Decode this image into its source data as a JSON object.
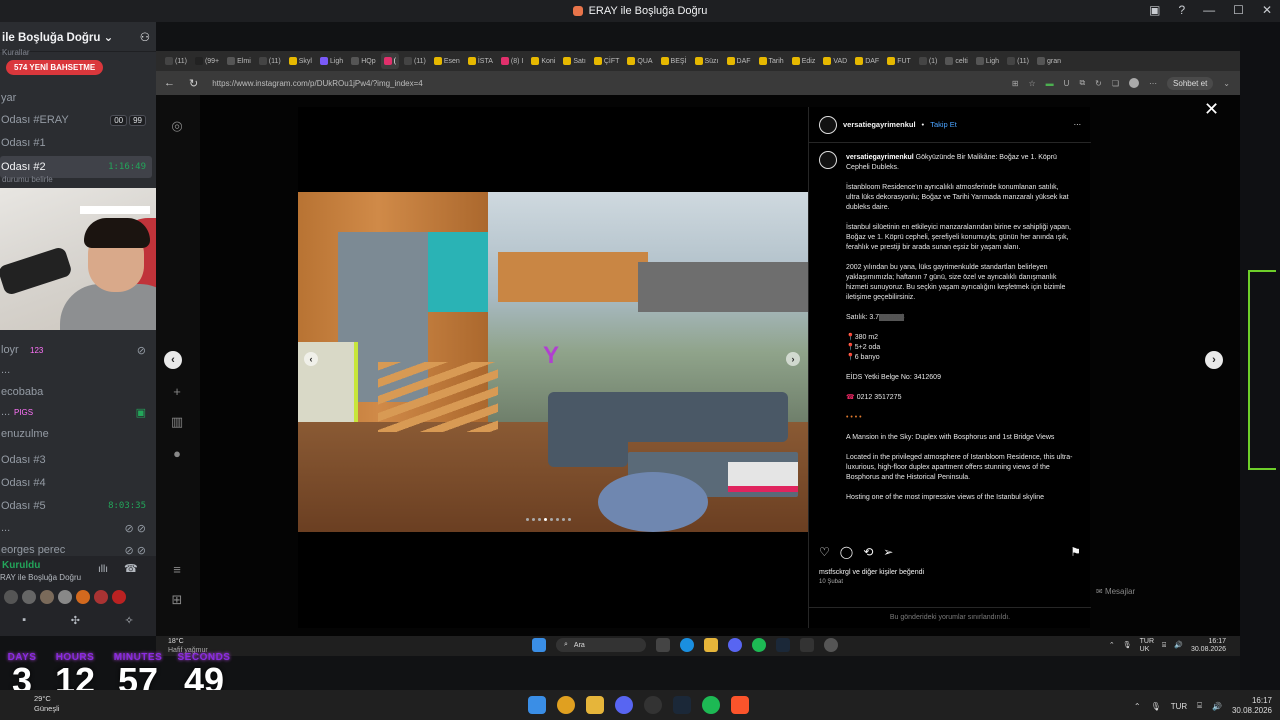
{
  "window": {
    "title": "ERAY ile Boşluğa Doğru"
  },
  "discord": {
    "server_name": "ile Boşluğa Doğru",
    "top_label": "Kurallar",
    "pill": "574 YENİ BAHSETME",
    "channels": [
      {
        "label": "yar"
      },
      {
        "label": "Odası #ERAY",
        "badge1": "00",
        "badge2": "99"
      },
      {
        "label": "Odası #1"
      },
      {
        "label": "Odası #2",
        "time": "1:16:49"
      },
      {
        "label": "durumu belirle"
      }
    ],
    "lower_channels": [
      {
        "label": "loyr",
        "tag": "123"
      },
      {
        "label": "..."
      },
      {
        "label": "ecobaba"
      },
      {
        "label": "...",
        "tag": "PIGS"
      },
      {
        "label": "enuzulme"
      },
      {
        "label": "Odası #3"
      },
      {
        "label": "Odası #4"
      },
      {
        "label": "Odası #5",
        "time": "8:03:35"
      },
      {
        "label": "..."
      },
      {
        "label": "eorges perec"
      }
    ],
    "voice_status": "Kuruldu",
    "voice_channel": "RAY ile Boşluğa Doğru"
  },
  "browser": {
    "tabs": [
      "(11)",
      "(99+",
      "Elmi",
      "(11)",
      "Skyl",
      "Ligh",
      "HQp",
      "(",
      "(11)",
      "Esen",
      "İSTA",
      "(8) I",
      "Koni",
      "Satı",
      "ÇİFT",
      "QUA",
      "BEŞİ",
      "Süzı",
      "DAF",
      "Tarih",
      "Ediz",
      "VAD",
      "DAF",
      "FUT",
      "(1)",
      "celti",
      "Ligh",
      "(11)",
      "gran"
    ],
    "url": "https://www.instagram.com/p/DUkROu1jPw4/?img_index=4",
    "sohbet": "Sohbet et"
  },
  "post": {
    "username": "versatiegayrimenkul",
    "follow": "Takip Et",
    "caption_title": "Gökyüzünde Bir Malikâne: Boğaz ve 1. Köprü Cepheli Dubleks.",
    "p1": "İstanbloom Residence'ın ayrıcalıklı atmosferinde konumlanan satılık, ultra lüks dekorasyonlu; Boğaz ve Tarihi Yarımada manzaralı yüksek kat dubleks daire.",
    "p2": "İstanbul silüetinin en etkileyici manzaralarından birine ev sahipliği yapan, Boğaz ve 1. Köprü cepheli, şerefiyeli konumuyla; günün her anında ışık, ferahlık ve prestiji bir arada sunan eşsiz bir yaşam alanı.",
    "p3": "2002 yılından bu yana, lüks gayrimenkulde standartları belirleyen yaklaşımımızla; haftanın 7 günü, size özel ve ayrıcalıklı danışmanlık hizmeti sunuyoruz. Bu seçkin yaşam ayrıcalığını keşfetmek için bizimle iletişime geçebilirsiniz.",
    "price": "Satılık: 3.7",
    "area": "380 m2",
    "rooms": "5+2 oda",
    "baths": "6 banyo",
    "license": "EİDS Yetki Belge No: 3412609",
    "phone": "0212 3517275",
    "dots": "• • • •",
    "en_title": "A Mansion in the Sky: Duplex with Bosphorus and 1st Bridge Views",
    "en_p1": "Located in the privileged atmosphere of Istanbloom Residence, this ultra-luxurious, high-floor duplex apartment offers stunning views of the Bosphorus and the Historical Peninsula.",
    "en_p2": "Hosting one of the most impressive views of the Istanbul skyline",
    "likes": "mstfsckrgl ve diğer kişiler beğendi",
    "date": "10 Şubat",
    "comments_off": "Bu gönderideki yorumlar sınırlandırıldı.",
    "messages": "Mesajlar"
  },
  "inner_taskbar": {
    "temp": "18°C",
    "weather": "Hafif yağmur",
    "search": "Ara",
    "lang1": "TUR",
    "lang2": "UK",
    "time": "16:17",
    "date": "30.08.2026"
  },
  "countdown": {
    "days_label": "DAYS",
    "days": "3",
    "hours_label": "HOURS",
    "hours": "12",
    "minutes_label": "MINUTES",
    "minutes": "57",
    "seconds_label": "SECONDS",
    "seconds": "49"
  },
  "taskbar": {
    "temp": "29°C",
    "weather": "Güneşli",
    "lang": "TUR",
    "time": "16:17",
    "date": "30.08.2026"
  }
}
